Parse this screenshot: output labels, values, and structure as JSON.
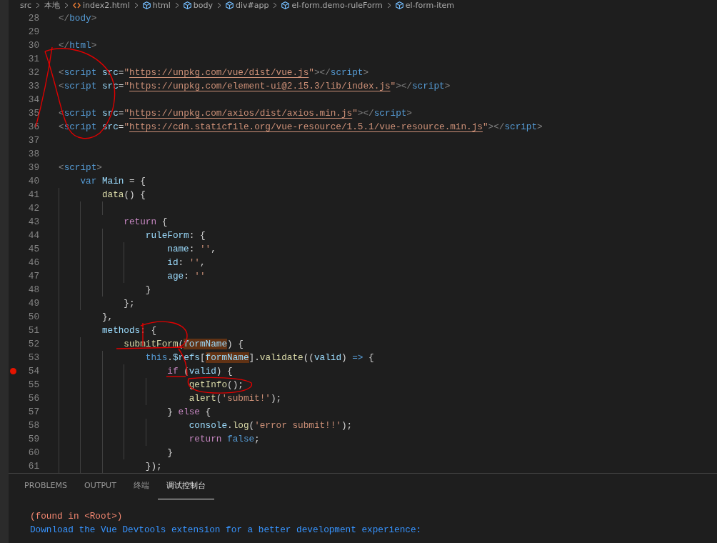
{
  "breadcrumb": [
    {
      "label": "src"
    },
    {
      "label": "本地"
    },
    {
      "label": "index2.html",
      "kind": "file"
    },
    {
      "label": "html",
      "kind": "element"
    },
    {
      "label": "body",
      "kind": "element"
    },
    {
      "label": "div#app",
      "kind": "element"
    },
    {
      "label": "el-form.demo-ruleForm",
      "kind": "element"
    },
    {
      "label": "el-form-item",
      "kind": "element"
    }
  ],
  "code_lines": [
    {
      "number": "28",
      "breakpoint": false,
      "tokens": [
        {
          "t": "</",
          "kind": "punct"
        },
        {
          "t": "body",
          "kind": "tag"
        },
        {
          "t": ">",
          "kind": "punct"
        }
      ]
    },
    {
      "number": "29",
      "breakpoint": false
    },
    {
      "number": "30",
      "breakpoint": false,
      "tokens": [
        {
          "t": "</",
          "kind": "punct"
        },
        {
          "t": "html",
          "kind": "tag"
        },
        {
          "t": ">",
          "kind": "punct"
        }
      ]
    },
    {
      "number": "31",
      "breakpoint": false
    },
    {
      "number": "32",
      "breakpoint": false,
      "tokens": [
        {
          "t": "<",
          "kind": "punct"
        },
        {
          "t": "script",
          "kind": "tag"
        },
        {
          "t": " src",
          "kind": "attr"
        },
        {
          "t": "=",
          "kind": "plain"
        },
        {
          "t": "\"",
          "kind": "string"
        },
        {
          "t": "https://unpkg.com/vue/dist/vue.js",
          "kind": "link"
        },
        {
          "t": "\"",
          "kind": "string"
        },
        {
          "t": "></",
          "kind": "punct"
        },
        {
          "t": "script",
          "kind": "tag"
        },
        {
          "t": ">",
          "kind": "punct"
        }
      ]
    },
    {
      "number": "33",
      "breakpoint": false,
      "tokens": [
        {
          "t": "<",
          "kind": "punct"
        },
        {
          "t": "script",
          "kind": "tag"
        },
        {
          "t": " src",
          "kind": "attr"
        },
        {
          "t": "=",
          "kind": "plain"
        },
        {
          "t": "\"",
          "kind": "string"
        },
        {
          "t": "https://unpkg.com/element-ui@2.15.3/lib/index.js",
          "kind": "link"
        },
        {
          "t": "\"",
          "kind": "string"
        },
        {
          "t": "></",
          "kind": "punct"
        },
        {
          "t": "script",
          "kind": "tag"
        },
        {
          "t": ">",
          "kind": "punct"
        }
      ]
    },
    {
      "number": "34",
      "breakpoint": false
    },
    {
      "number": "35",
      "breakpoint": false,
      "tokens": [
        {
          "t": "<",
          "kind": "punct"
        },
        {
          "t": "script",
          "kind": "tag"
        },
        {
          "t": " src",
          "kind": "attr"
        },
        {
          "t": "=",
          "kind": "plain"
        },
        {
          "t": "\"",
          "kind": "string"
        },
        {
          "t": "https://unpkg.com/axios/dist/axios.min.js",
          "kind": "link"
        },
        {
          "t": "\"",
          "kind": "string"
        },
        {
          "t": "></",
          "kind": "punct"
        },
        {
          "t": "script",
          "kind": "tag"
        },
        {
          "t": ">",
          "kind": "punct"
        }
      ]
    },
    {
      "number": "36",
      "breakpoint": false,
      "tokens": [
        {
          "t": "<",
          "kind": "punct"
        },
        {
          "t": "script",
          "kind": "tag"
        },
        {
          "t": " src",
          "kind": "attr"
        },
        {
          "t": "=",
          "kind": "plain"
        },
        {
          "t": "\"",
          "kind": "string"
        },
        {
          "t": "https://cdn.staticfile.org/vue-resource/1.5.1/vue-resource.min.js",
          "kind": "link"
        },
        {
          "t": "\"",
          "kind": "string"
        },
        {
          "t": "></",
          "kind": "punct"
        },
        {
          "t": "script",
          "kind": "tag"
        },
        {
          "t": ">",
          "kind": "punct"
        }
      ]
    },
    {
      "number": "37",
      "breakpoint": false
    },
    {
      "number": "38",
      "breakpoint": false
    },
    {
      "number": "39",
      "breakpoint": false,
      "tokens": [
        {
          "t": "<",
          "kind": "punct"
        },
        {
          "t": "script",
          "kind": "tag"
        },
        {
          "t": ">",
          "kind": "punct"
        }
      ]
    },
    {
      "number": "40",
      "breakpoint": false,
      "tokens": [
        {
          "t": "    var",
          "kind": "keyword"
        },
        {
          "t": " Main",
          "kind": "variable"
        },
        {
          "t": " = {",
          "kind": "plain"
        }
      ]
    },
    {
      "number": "41",
      "breakpoint": false,
      "tokens": [
        {
          "t": "        data",
          "kind": "function"
        },
        {
          "t": "() {",
          "kind": "plain"
        }
      ]
    },
    {
      "number": "42",
      "breakpoint": false
    },
    {
      "number": "43",
      "breakpoint": false,
      "tokens": [
        {
          "t": "            return",
          "kind": "control"
        },
        {
          "t": " {",
          "kind": "plain"
        }
      ]
    },
    {
      "number": "44",
      "breakpoint": false,
      "tokens": [
        {
          "t": "                ruleForm",
          "kind": "variable"
        },
        {
          "t": ": {",
          "kind": "plain"
        }
      ]
    },
    {
      "number": "45",
      "breakpoint": false,
      "tokens": [
        {
          "t": "                    name",
          "kind": "variable"
        },
        {
          "t": ": ",
          "kind": "plain"
        },
        {
          "t": "''",
          "kind": "string"
        },
        {
          "t": ",",
          "kind": "plain"
        }
      ]
    },
    {
      "number": "46",
      "breakpoint": false,
      "tokens": [
        {
          "t": "                    id",
          "kind": "variable"
        },
        {
          "t": ": ",
          "kind": "plain"
        },
        {
          "t": "''",
          "kind": "string"
        },
        {
          "t": ",",
          "kind": "plain"
        }
      ]
    },
    {
      "number": "47",
      "breakpoint": false,
      "tokens": [
        {
          "t": "                    age",
          "kind": "variable"
        },
        {
          "t": ": ",
          "kind": "plain"
        },
        {
          "t": "''",
          "kind": "string"
        }
      ]
    },
    {
      "number": "48",
      "breakpoint": false,
      "tokens": [
        {
          "t": "                }",
          "kind": "plain"
        }
      ]
    },
    {
      "number": "49",
      "breakpoint": false,
      "tokens": [
        {
          "t": "            };",
          "kind": "plain"
        }
      ]
    },
    {
      "number": "50",
      "breakpoint": false,
      "tokens": [
        {
          "t": "        },",
          "kind": "plain"
        }
      ]
    },
    {
      "number": "51",
      "breakpoint": false,
      "tokens": [
        {
          "t": "        methods",
          "kind": "variable"
        },
        {
          "t": ": {",
          "kind": "plain"
        }
      ]
    },
    {
      "number": "52",
      "breakpoint": false,
      "tokens": [
        {
          "t": "            submitForm",
          "kind": "function"
        },
        {
          "t": "(",
          "kind": "plain"
        },
        {
          "t": "formName",
          "kind": "highlight"
        },
        {
          "t": ") {",
          "kind": "plain"
        }
      ]
    },
    {
      "number": "53",
      "breakpoint": false,
      "tokens": [
        {
          "t": "                this",
          "kind": "keyword"
        },
        {
          "t": ".",
          "kind": "plain"
        },
        {
          "t": "$refs",
          "kind": "variable"
        },
        {
          "t": "[",
          "kind": "plain"
        },
        {
          "t": "formName",
          "kind": "highlight"
        },
        {
          "t": "].",
          "kind": "plain"
        },
        {
          "t": "validate",
          "kind": "function"
        },
        {
          "t": "((",
          "kind": "plain"
        },
        {
          "t": "valid",
          "kind": "variable"
        },
        {
          "t": ") ",
          "kind": "plain"
        },
        {
          "t": "=>",
          "kind": "keyword"
        },
        {
          "t": " {",
          "kind": "plain"
        }
      ]
    },
    {
      "number": "54",
      "breakpoint": true,
      "tokens": [
        {
          "t": "                    if",
          "kind": "control"
        },
        {
          "t": " (",
          "kind": "plain"
        },
        {
          "t": "valid",
          "kind": "variable"
        },
        {
          "t": ") {",
          "kind": "plain"
        }
      ]
    },
    {
      "number": "55",
      "breakpoint": false,
      "tokens": [
        {
          "t": "                        getInfo",
          "kind": "function"
        },
        {
          "t": "();",
          "kind": "plain"
        }
      ]
    },
    {
      "number": "56",
      "breakpoint": false,
      "tokens": [
        {
          "t": "                        alert",
          "kind": "function"
        },
        {
          "t": "(",
          "kind": "plain"
        },
        {
          "t": "'submit!'",
          "kind": "string"
        },
        {
          "t": ");",
          "kind": "plain"
        }
      ]
    },
    {
      "number": "57",
      "breakpoint": false,
      "tokens": [
        {
          "t": "                    } ",
          "kind": "plain"
        },
        {
          "t": "else",
          "kind": "control"
        },
        {
          "t": " {",
          "kind": "plain"
        }
      ]
    },
    {
      "number": "58",
      "breakpoint": false,
      "tokens": [
        {
          "t": "                        console",
          "kind": "variable"
        },
        {
          "t": ".",
          "kind": "plain"
        },
        {
          "t": "log",
          "kind": "function"
        },
        {
          "t": "(",
          "kind": "plain"
        },
        {
          "t": "'error submit!!'",
          "kind": "string"
        },
        {
          "t": ");",
          "kind": "plain"
        }
      ]
    },
    {
      "number": "59",
      "breakpoint": false,
      "tokens": [
        {
          "t": "                        return",
          "kind": "control"
        },
        {
          "t": " false",
          "kind": "keyword"
        },
        {
          "t": ";",
          "kind": "plain"
        }
      ]
    },
    {
      "number": "60",
      "breakpoint": false,
      "tokens": [
        {
          "t": "                    }",
          "kind": "plain"
        }
      ]
    },
    {
      "number": "61",
      "breakpoint": false,
      "tokens": [
        {
          "t": "                });",
          "kind": "plain"
        }
      ]
    }
  ],
  "panel_tabs": [
    {
      "label": "PROBLEMS",
      "selected": false
    },
    {
      "label": "OUTPUT",
      "selected": false
    },
    {
      "label": "终端",
      "selected": false
    },
    {
      "label": "调试控制台",
      "selected": true
    }
  ],
  "console_lines": [
    {
      "text": "(found in <Root>)",
      "kind": "error"
    },
    {
      "text": "Download the Vue Devtools extension for a better development experience:",
      "kind": "info"
    }
  ]
}
